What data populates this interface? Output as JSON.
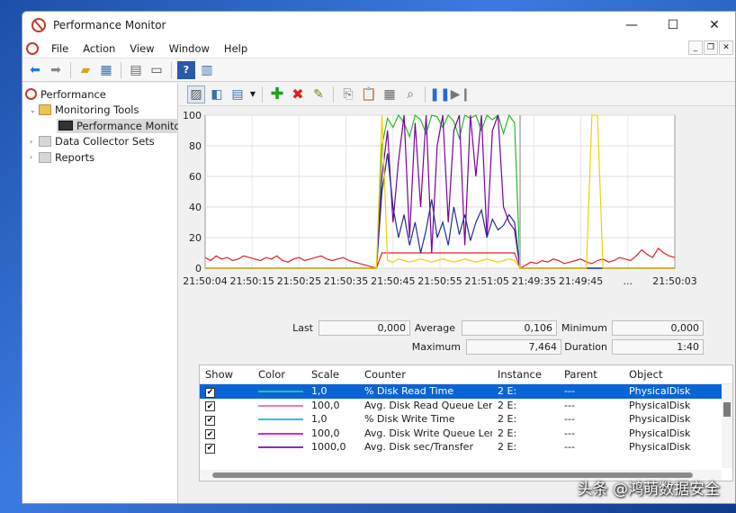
{
  "window": {
    "title": "Performance Monitor"
  },
  "window_controls": {
    "minimize": "—",
    "maximize": "☐",
    "close": "✕"
  },
  "menu": {
    "items": [
      "File",
      "Action",
      "View",
      "Window",
      "Help"
    ]
  },
  "tree": {
    "root": "Performance",
    "monitoring_tools": "Monitoring Tools",
    "performance_monitor": "Performance Monitor",
    "data_collector_sets": "Data Collector Sets",
    "reports": "Reports"
  },
  "chart_data": {
    "type": "line",
    "ylim": [
      0,
      100
    ],
    "yticks": [
      "100",
      "80",
      "60",
      "40",
      "20",
      "0"
    ],
    "xtick_labels": [
      "21:50:04",
      "21:50:15",
      "21:50:25",
      "21:50:35",
      "21:50:45",
      "21:50:55",
      "21:51:05",
      "21:49:35",
      "21:49:45",
      "...",
      "21:50:03"
    ],
    "grid": true,
    "series": [
      {
        "color": "#e02020",
        "values": [
          7,
          5,
          8,
          6,
          7,
          5,
          6,
          8,
          7,
          6,
          5,
          7,
          6,
          8,
          5,
          4,
          6,
          7,
          5,
          6,
          7,
          8,
          6,
          5,
          6,
          7,
          5,
          4,
          3,
          2,
          1,
          0,
          10,
          10,
          10,
          10,
          10,
          10,
          10,
          10,
          10,
          10,
          10,
          10,
          10,
          10,
          10,
          10,
          10,
          10,
          10,
          10,
          10,
          10,
          10,
          10,
          10,
          0,
          2,
          4,
          3,
          5,
          4,
          6,
          5,
          3,
          4,
          5,
          6,
          4,
          3,
          5,
          6,
          4,
          5,
          7,
          6,
          5,
          8,
          12,
          9,
          7,
          13,
          10,
          8,
          7
        ]
      },
      {
        "color": "#22bb22",
        "values": [
          0,
          0,
          0,
          0,
          0,
          0,
          0,
          0,
          0,
          0,
          0,
          0,
          0,
          0,
          0,
          0,
          0,
          0,
          0,
          0,
          0,
          0,
          0,
          0,
          0,
          0,
          0,
          0,
          0,
          0,
          0,
          0,
          80,
          98,
          92,
          100,
          95,
          86,
          100,
          97,
          88,
          100,
          99,
          92,
          100,
          96,
          85,
          100,
          98,
          100,
          90,
          100,
          97,
          100,
          88,
          100,
          95,
          0,
          0,
          0,
          0,
          0,
          0,
          0,
          0,
          0,
          0,
          0,
          0,
          0,
          0,
          0,
          0,
          0,
          0,
          0,
          0,
          0,
          0,
          0,
          0,
          0,
          0,
          0,
          0,
          0
        ]
      },
      {
        "color": "#7a00a0",
        "values": [
          0,
          0,
          0,
          0,
          0,
          0,
          0,
          0,
          0,
          0,
          0,
          0,
          0,
          0,
          0,
          0,
          0,
          0,
          0,
          0,
          0,
          0,
          0,
          0,
          0,
          0,
          0,
          0,
          0,
          0,
          0,
          0,
          60,
          90,
          30,
          70,
          100,
          20,
          95,
          40,
          100,
          10,
          80,
          100,
          30,
          90,
          100,
          15,
          100,
          60,
          100,
          20,
          90,
          100,
          40,
          30,
          25,
          0,
          0,
          0,
          0,
          0,
          0,
          0,
          0,
          0,
          0,
          0,
          0,
          0,
          0,
          0,
          0,
          0,
          0,
          0,
          0,
          0,
          0,
          0,
          0,
          0,
          0,
          0,
          0,
          0
        ]
      },
      {
        "color": "#1f2f9a",
        "values": [
          0,
          0,
          0,
          0,
          0,
          0,
          0,
          0,
          0,
          0,
          0,
          0,
          0,
          0,
          0,
          0,
          0,
          0,
          0,
          0,
          0,
          0,
          0,
          0,
          0,
          0,
          0,
          0,
          0,
          0,
          0,
          0,
          50,
          75,
          40,
          20,
          35,
          15,
          30,
          10,
          25,
          45,
          20,
          30,
          15,
          40,
          22,
          35,
          18,
          30,
          38,
          20,
          32,
          25,
          28,
          35,
          30,
          0,
          0,
          0,
          0,
          0,
          0,
          0,
          0,
          0,
          0,
          0,
          0,
          0,
          0,
          0,
          0,
          0,
          0,
          0,
          0,
          0,
          0,
          0,
          0,
          0,
          0,
          0,
          0,
          0
        ]
      },
      {
        "color": "#f2d000",
        "values": [
          0,
          0,
          0,
          0,
          0,
          0,
          0,
          0,
          0,
          0,
          0,
          0,
          0,
          0,
          0,
          0,
          0,
          0,
          0,
          0,
          0,
          0,
          0,
          0,
          0,
          0,
          0,
          0,
          0,
          0,
          0,
          0,
          100,
          5,
          4,
          6,
          5,
          4,
          5,
          6,
          5,
          4,
          5,
          6,
          5,
          4,
          5,
          6,
          5,
          4,
          5,
          6,
          5,
          4,
          5,
          6,
          5,
          0,
          0,
          0,
          0,
          0,
          0,
          0,
          0,
          0,
          0,
          0,
          0,
          0,
          100,
          100,
          0,
          0,
          0,
          0,
          0,
          0,
          0,
          0,
          0,
          0,
          0,
          0,
          0,
          0
        ]
      }
    ]
  },
  "stats": {
    "last_label": "Last",
    "last_value": "0,000",
    "average_label": "Average",
    "average_value": "0,106",
    "minimum_label": "Minimum",
    "minimum_value": "0,000",
    "maximum_label": "Maximum",
    "maximum_value": "7,464",
    "duration_label": "Duration",
    "duration_value": "1:40"
  },
  "counters": {
    "headers": [
      "Show",
      "Color",
      "Scale",
      "Counter",
      "Instance",
      "Parent",
      "Object"
    ],
    "rows": [
      {
        "color": "#2bbf9f",
        "scale": "1,0",
        "counter": "% Disk Read Time",
        "instance": "2 E:",
        "parent": "---",
        "object": "PhysicalDisk",
        "selected": true
      },
      {
        "color": "#f07aa8",
        "scale": "100,0",
        "counter": "Avg. Disk Read Queue Len...",
        "instance": "2 E:",
        "parent": "---",
        "object": "PhysicalDisk",
        "selected": false
      },
      {
        "color": "#3fb7ea",
        "scale": "1,0",
        "counter": "% Disk Write Time",
        "instance": "2 E:",
        "parent": "---",
        "object": "PhysicalDisk",
        "selected": false
      },
      {
        "color": "#e020e0",
        "scale": "100,0",
        "counter": "Avg. Disk Write Queue Len...",
        "instance": "2 E:",
        "parent": "---",
        "object": "PhysicalDisk",
        "selected": false
      },
      {
        "color": "#8a2fb0",
        "scale": "1000,0",
        "counter": "Avg. Disk sec/Transfer",
        "instance": "2 E:",
        "parent": "---",
        "object": "PhysicalDisk",
        "selected": false
      }
    ]
  },
  "watermark": "头条 @鸿萌数据安全"
}
